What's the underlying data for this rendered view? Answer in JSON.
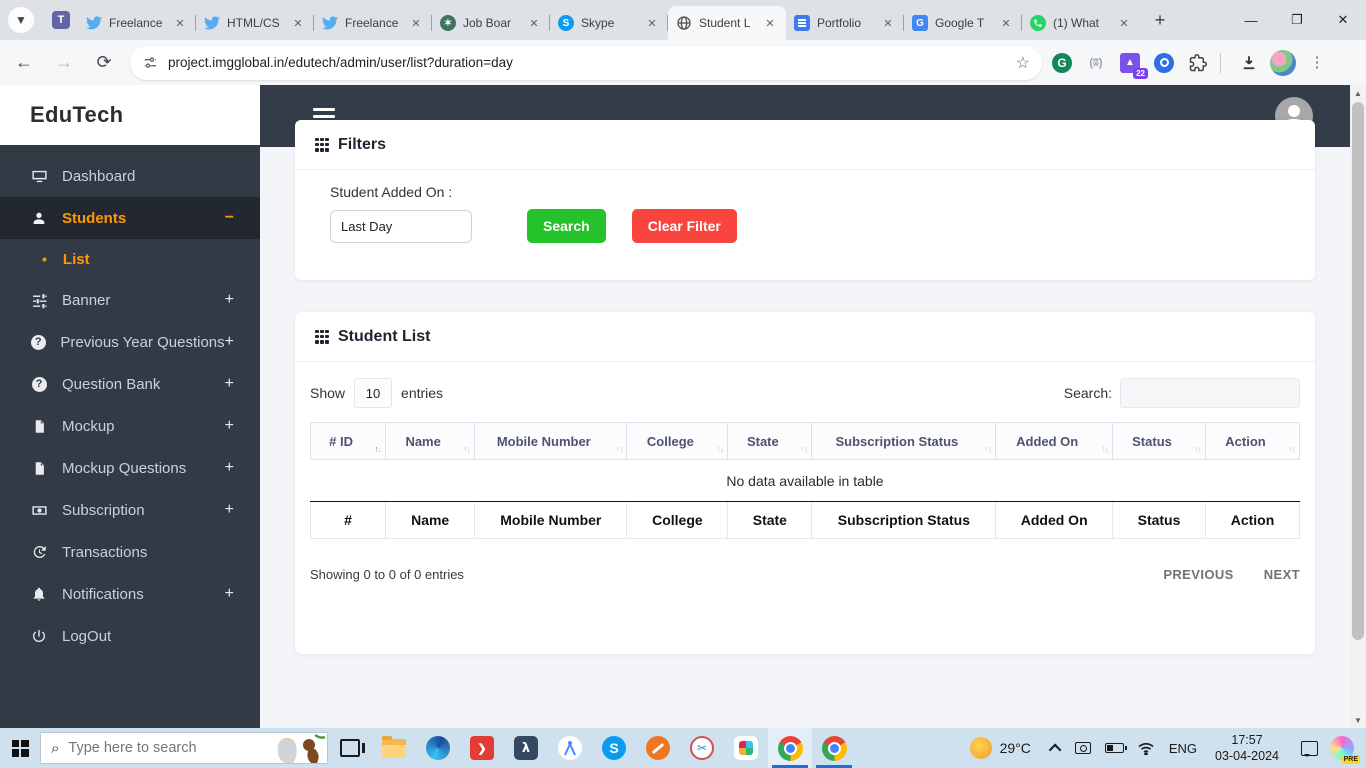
{
  "browser": {
    "tabs": [
      {
        "title": "Freelance",
        "icon": "twitter-icon"
      },
      {
        "title": "HTML/CS",
        "icon": "twitter-icon"
      },
      {
        "title": "Freelance",
        "icon": "twitter-icon"
      },
      {
        "title": "Job Boar",
        "icon": "chatgpt-icon"
      },
      {
        "title": "Skype",
        "icon": "skype-icon"
      },
      {
        "title": "Student L",
        "icon": "globe-icon"
      },
      {
        "title": "Portfolio",
        "icon": "docs-icon"
      },
      {
        "title": "Google T",
        "icon": "translate-icon"
      },
      {
        "title": "(1) What",
        "icon": "whatsapp-icon"
      }
    ],
    "url": "project.imgglobal.in/edutech/admin/user/list?duration=day",
    "extension_badge": "22"
  },
  "sidebar": {
    "logo": "EduTech",
    "items": [
      {
        "label": "Dashboard"
      },
      {
        "label": "Students",
        "expander": "−"
      },
      {
        "label": "List",
        "bullet": "•"
      },
      {
        "label": "Banner",
        "expander": "+"
      },
      {
        "label": "Previous Year Questions",
        "expander": "+"
      },
      {
        "label": "Question Bank",
        "expander": "+"
      },
      {
        "label": "Mockup",
        "expander": "+"
      },
      {
        "label": "Mockup Questions",
        "expander": "+"
      },
      {
        "label": "Subscription",
        "expander": "+"
      },
      {
        "label": "Transactions"
      },
      {
        "label": "Notifications",
        "expander": "+"
      },
      {
        "label": "LogOut"
      }
    ]
  },
  "filters": {
    "title": "Filters",
    "label": "Student Added On :",
    "value": "Last Day",
    "search_button": "Search",
    "clear_button": "Clear Filter"
  },
  "list": {
    "title": "Student List",
    "show_label": "Show",
    "page_size": "10",
    "entries_label": "entries",
    "search_label": "Search:",
    "columns": [
      "# ID",
      "Name",
      "Mobile Number",
      "College",
      "State",
      "Subscription Status",
      "Added On",
      "Status",
      "Action"
    ],
    "footer_columns": [
      "#",
      "Name",
      "Mobile Number",
      "College",
      "State",
      "Subscription Status",
      "Added On",
      "Status",
      "Action"
    ],
    "empty_message": "No data available in table",
    "info": "Showing 0 to 0 of 0 entries",
    "previous_label": "PREVIOUS",
    "next_label": "NEXT"
  },
  "taskbar": {
    "search_placeholder": "Type here to search",
    "temperature": "29°C",
    "language": "ENG",
    "time": "17:57",
    "date": "03-04-2024",
    "copilot_badge": "PRE"
  },
  "colors": {
    "accent_orange": "#ff9800",
    "sidebar_dark": "#323a46",
    "green_button": "#25c32b",
    "red_button": "#f8463f"
  }
}
